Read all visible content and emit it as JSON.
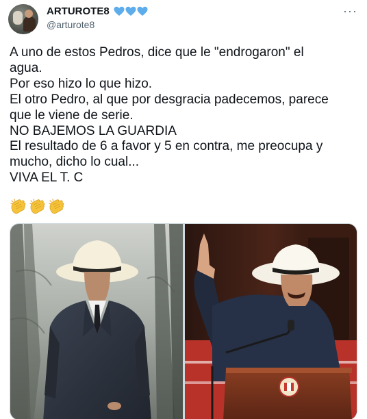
{
  "tweet": {
    "author": {
      "display_name": "ARTUROTE8",
      "handle": "@arturote8",
      "badges": [
        "blue-heart-icon",
        "blue-heart-icon",
        "blue-heart-icon"
      ]
    },
    "more_options": "···",
    "text_lines": [
      "A uno de estos Pedros, dice que le \"endrogaron\" el",
      "agua.",
      "Por eso hizo lo que hizo.",
      "El otro Pedro, al que por desgracia padecemos, parece",
      "que le viene de serie.",
      "NO BAJEMOS LA GUARDIA",
      "El resultado de 6 a favor y 5 en contra, me preocupa y",
      "mucho, dicho lo cual...",
      "VIVA EL T. C"
    ],
    "emoji": [
      "clapping-hands-icon",
      "clapping-hands-icon",
      "clapping-hands-icon"
    ],
    "media": [
      {
        "name": "photo-man-suit-white-hat"
      },
      {
        "name": "photo-man-speaking-podium-white-hat"
      }
    ]
  },
  "colors": {
    "text": "#0f1419",
    "secondary": "#536471",
    "heart_blue": "#5dadec",
    "border": "#cfd9de"
  }
}
